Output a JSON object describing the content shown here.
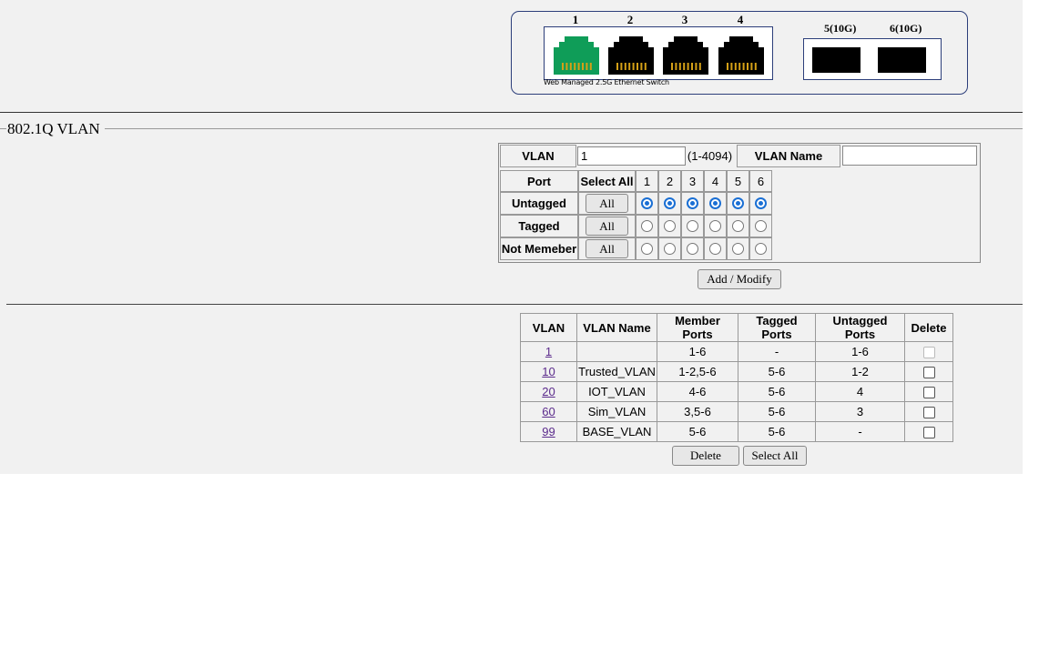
{
  "switch_panel": {
    "rj_ports": [
      {
        "num": "1",
        "state": "up",
        "color": "#0f9d58"
      },
      {
        "num": "2",
        "state": "down",
        "color": "#000000"
      },
      {
        "num": "3",
        "state": "down",
        "color": "#000000"
      },
      {
        "num": "4",
        "state": "down",
        "color": "#000000"
      }
    ],
    "sfp_ports": [
      {
        "num": "5(10G)"
      },
      {
        "num": "6(10G)"
      }
    ],
    "caption": "Web Managed 2.5G Ethernet Switch"
  },
  "section_title": "802.1Q VLAN",
  "form": {
    "vlan_label": "VLAN",
    "vlan_value": "1",
    "vlan_range": "(1-4094)",
    "vlan_name_label": "VLAN Name",
    "vlan_name_value": "",
    "port_header": "Port",
    "select_all_header": "Select All",
    "port_numbers": [
      "1",
      "2",
      "3",
      "4",
      "5",
      "6"
    ],
    "rows": [
      {
        "label": "Untagged",
        "button": "All",
        "selected": [
          true,
          true,
          true,
          true,
          true,
          true
        ]
      },
      {
        "label": "Tagged",
        "button": "All",
        "selected": [
          false,
          false,
          false,
          false,
          false,
          false
        ]
      },
      {
        "label": "Not Memeber",
        "button": "All",
        "selected": [
          false,
          false,
          false,
          false,
          false,
          false
        ]
      }
    ],
    "submit_label": "Add / Modify"
  },
  "vlan_list": {
    "headers": [
      "VLAN",
      "VLAN Name",
      "Member Ports",
      "Tagged Ports",
      "Untagged Ports",
      "Delete"
    ],
    "rows": [
      {
        "vlan": "1",
        "name": "",
        "member": "1-6",
        "tagged": "-",
        "untagged": "1-6",
        "delete_disabled": true
      },
      {
        "vlan": "10",
        "name": "Trusted_VLAN",
        "member": "1-2,5-6",
        "tagged": "5-6",
        "untagged": "1-2",
        "delete_disabled": false
      },
      {
        "vlan": "20",
        "name": "IOT_VLAN",
        "member": "4-6",
        "tagged": "5-6",
        "untagged": "4",
        "delete_disabled": false
      },
      {
        "vlan": "60",
        "name": "Sim_VLAN",
        "member": "3,5-6",
        "tagged": "5-6",
        "untagged": "3",
        "delete_disabled": false
      },
      {
        "vlan": "99",
        "name": "BASE_VLAN",
        "member": "5-6",
        "tagged": "5-6",
        "untagged": "-",
        "delete_disabled": false
      }
    ],
    "delete_label": "Delete",
    "select_all_label": "Select All"
  }
}
